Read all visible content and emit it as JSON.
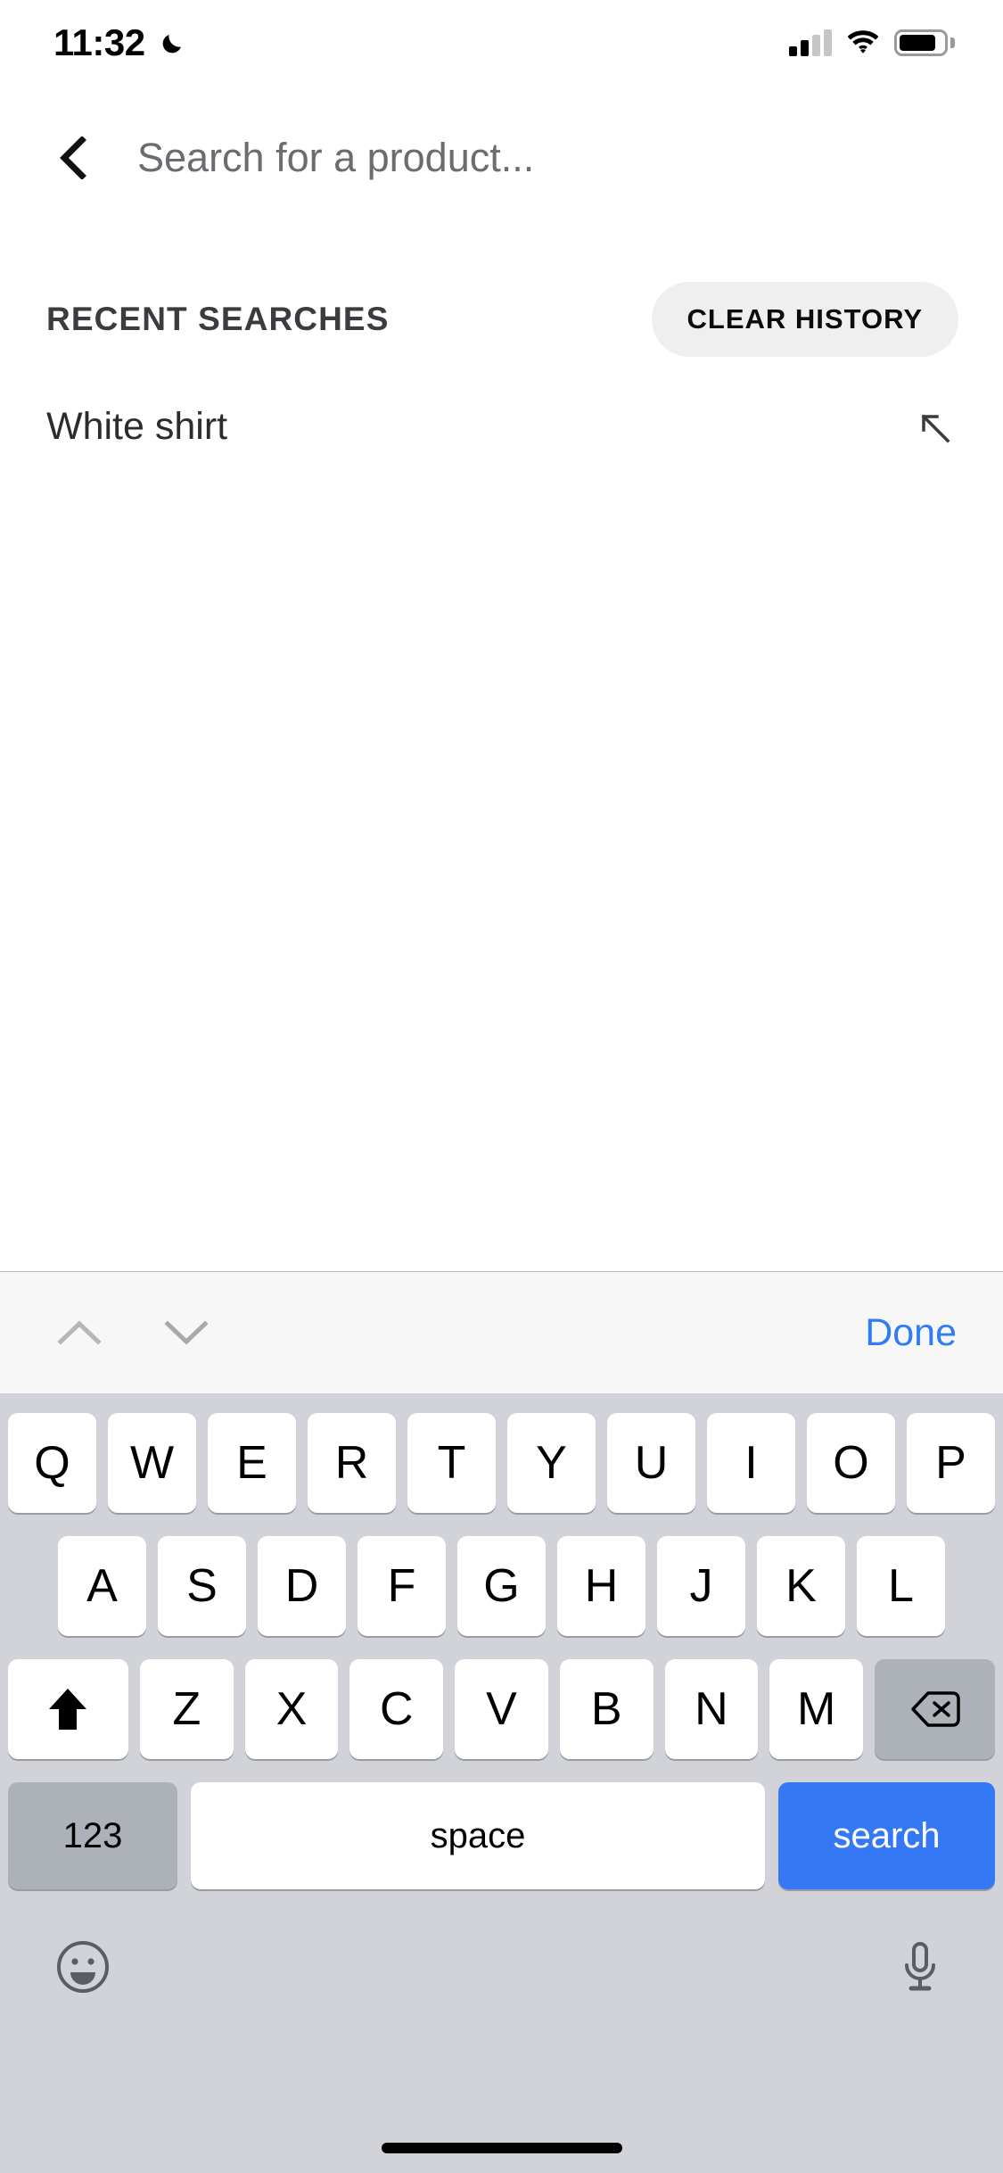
{
  "status_bar": {
    "time": "11:32",
    "dnd_icon": "moon-icon",
    "signal_icon": "cellular-signal-icon",
    "signal_bars_filled": 2,
    "signal_bars_total": 4,
    "wifi_icon": "wifi-icon",
    "battery_icon": "battery-icon",
    "battery_level_pct": 84
  },
  "header": {
    "back_icon": "chevron-left-icon",
    "search_value": "",
    "search_placeholder": "Search for a product..."
  },
  "recent": {
    "title": "RECENT SEARCHES",
    "clear_label": "CLEAR HISTORY",
    "items": [
      {
        "label": "White shirt",
        "action_icon": "arrow-up-left-icon"
      }
    ]
  },
  "keyboard_accessory": {
    "prev_icon": "chevron-up-icon",
    "next_icon": "chevron-down-icon",
    "done_label": "Done"
  },
  "keyboard": {
    "row1": [
      "Q",
      "W",
      "E",
      "R",
      "T",
      "Y",
      "U",
      "I",
      "O",
      "P"
    ],
    "row2": [
      "A",
      "S",
      "D",
      "F",
      "G",
      "H",
      "J",
      "K",
      "L"
    ],
    "row3": [
      "Z",
      "X",
      "C",
      "V",
      "B",
      "N",
      "M"
    ],
    "shift_icon": "shift-icon",
    "delete_icon": "backspace-icon",
    "numbers_label": "123",
    "space_label": "space",
    "return_label": "search",
    "emoji_icon": "emoji-smiley-icon",
    "mic_icon": "microphone-icon"
  },
  "colors": {
    "accent_blue": "#3478f6",
    "done_blue": "#2f7cf6",
    "keyboard_bg": "#d1d3d9",
    "key_bg": "#ffffff",
    "key_fn_bg": "#adb1b8",
    "pill_bg": "#efeff0"
  }
}
